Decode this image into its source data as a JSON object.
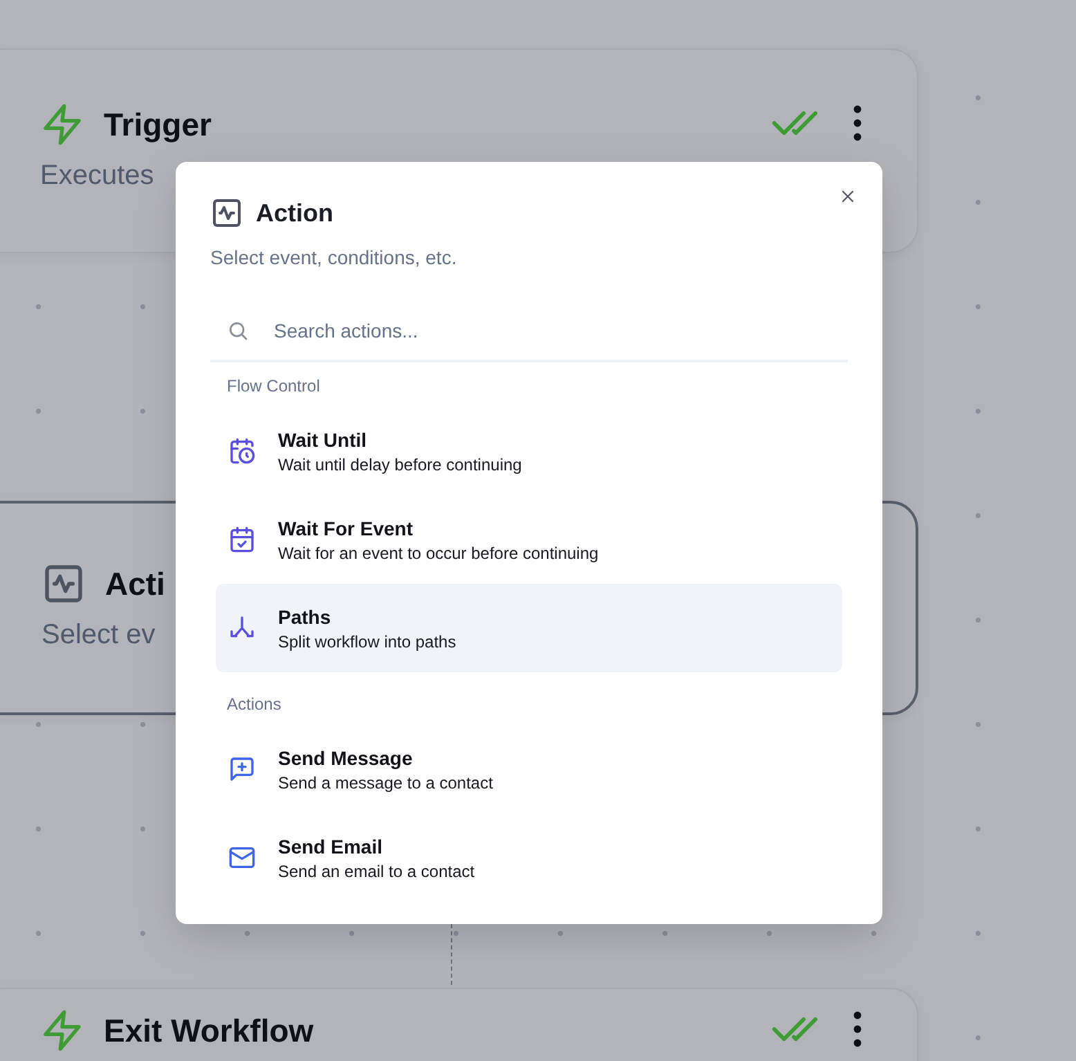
{
  "nodes": [
    {
      "kind": "trigger",
      "title": "Trigger",
      "subtitle": "Executes",
      "selected": false
    },
    {
      "kind": "action",
      "title": "Acti",
      "subtitle": "Select ev",
      "selected": true
    },
    {
      "kind": "exit",
      "title": "Exit Workflow",
      "selected": false
    }
  ],
  "dialog": {
    "title": "Action",
    "subtitle": "Select event, conditions, etc.",
    "search": {
      "placeholder": "Search actions..."
    },
    "sections": [
      {
        "label": "Flow Control",
        "items": [
          {
            "kind": "wait-until",
            "title": "Wait Until",
            "description": "Wait until delay before continuing",
            "selected": false
          },
          {
            "kind": "wait-event",
            "title": "Wait For Event",
            "description": "Wait for an event to occur before continuing",
            "selected": false
          },
          {
            "kind": "paths",
            "title": "Paths",
            "description": "Split workflow into paths",
            "selected": true
          }
        ]
      },
      {
        "label": "Actions",
        "items": [
          {
            "kind": "message",
            "title": "Send Message",
            "description": "Send a message to a contact",
            "selected": false
          },
          {
            "kind": "email",
            "title": "Send Email",
            "description": "Send an email to a contact",
            "selected": false
          }
        ]
      }
    ]
  }
}
